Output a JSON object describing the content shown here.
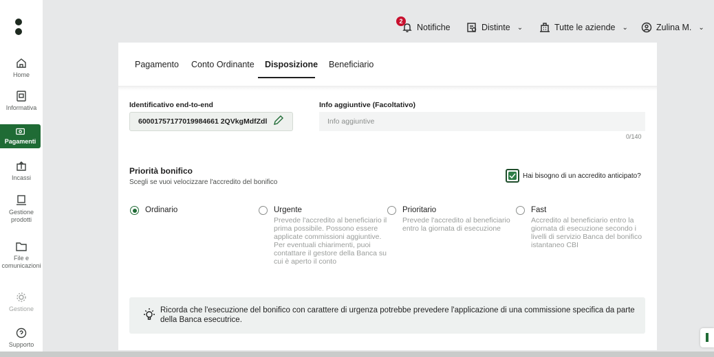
{
  "sidebar": {
    "items": [
      {
        "label": "Home",
        "icon": "home-icon"
      },
      {
        "label": "Informativa",
        "icon": "document-icon"
      },
      {
        "label": "Pagamenti",
        "icon": "payments-icon"
      },
      {
        "label": "Incassi",
        "icon": "incassi-icon"
      },
      {
        "label": "Gestione prodotti",
        "icon": "products-icon"
      },
      {
        "label": "File e comunicazioni",
        "icon": "folder-icon"
      },
      {
        "label": "Gestione",
        "icon": "gear-icon"
      },
      {
        "label": "Supporto",
        "icon": "support-icon"
      }
    ]
  },
  "topbar": {
    "notifications_label": "Notifiche",
    "notifications_count": "2",
    "distinte_label": "Distinte",
    "companies_label": "Tutte le aziende",
    "user_label": "Zulina M."
  },
  "tabs": [
    "Pagamento",
    "Conto Ordinante",
    "Disposizione",
    "Beneficiario"
  ],
  "form": {
    "e2e_label": "Identificativo end-to-end",
    "e2e_value": "60001757177019984661 2QVkgMdfZdl",
    "info_label": "Info aggiuntive (Facoltativo)",
    "info_placeholder": "Info aggiuntive",
    "info_counter": "0/140"
  },
  "priority": {
    "title": "Priorità bonifico",
    "subtitle": "Scegli se vuoi velocizzare l'accredito del bonifico",
    "checkbox_label": "Hai bisogno di un accredito anticipato?",
    "options": [
      {
        "title": "Ordinario",
        "desc": ""
      },
      {
        "title": "Urgente",
        "desc": "Prevede l'accredito al beneficiario il prima possibile. Possono essere applicate commissioni aggiuntive. Per eventuali chiarimenti, puoi contattare il gestore della Banca su cui è aperto il conto"
      },
      {
        "title": "Prioritario",
        "desc": "Prevede l'accredito al beneficiario entro la giornata di esecuzione"
      },
      {
        "title": "Fast",
        "desc": "Accredito al beneficiario entro la giornata di esecuzione secondo i livelli di servizio Banca del bonifico istantaneo CBI"
      }
    ]
  },
  "notice": {
    "text": "Ricorda che l'esecuzione del bonifico con carattere di urgenza potrebbe prevedere l'applicazione di una commissione specifica da parte della Banca esecutrice."
  },
  "colors": {
    "accent": "#1f6b35",
    "badge": "#c8102e"
  }
}
